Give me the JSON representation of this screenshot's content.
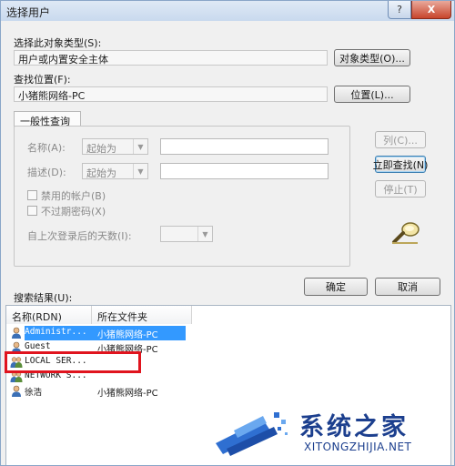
{
  "window": {
    "title": "选择用户",
    "help_label": "?",
    "close_label": "X"
  },
  "object_type": {
    "label": "选择此对象类型(S):",
    "value": "用户或内置安全主体",
    "button": "对象类型(O)..."
  },
  "location": {
    "label": "查找位置(F):",
    "value": "小猪熊网络-PC",
    "button": "位置(L)..."
  },
  "common_query": {
    "tab_label": "一般性查询",
    "name_label": "名称(A):",
    "name_mode": "起始为",
    "desc_label": "描述(D):",
    "desc_mode": "起始为",
    "disabled_accounts": "禁用的帐户(B)",
    "no_expire_password": "不过期密码(X)",
    "days_since_login": "自上次登录后的天数(I):"
  },
  "side_buttons": {
    "columns": "列(C)...",
    "find_now": "立即查找(N)",
    "stop": "停止(T)"
  },
  "actions": {
    "ok": "确定",
    "cancel": "取消"
  },
  "results": {
    "label": "搜索结果(U):",
    "columns": [
      "名称(RDN)",
      "所在文件夹"
    ],
    "rows": [
      {
        "name": "Administr...",
        "folder": "小猪熊网络-PC",
        "selected": true,
        "icon": "user-icon"
      },
      {
        "name": "Guest",
        "folder": "小猪熊网络-PC",
        "selected": false,
        "icon": "user-icon"
      },
      {
        "name": "LOCAL SER...",
        "folder": "",
        "selected": false,
        "icon": "group-icon"
      },
      {
        "name": "NETWORK S...",
        "folder": "",
        "selected": false,
        "icon": "group-icon"
      },
      {
        "name": "徐浩",
        "folder": "小猪熊网络-PC",
        "selected": false,
        "icon": "user-icon"
      }
    ]
  },
  "watermark": {
    "title": "系统之家",
    "url": "XITONGZHIJIA.NET"
  },
  "colors": {
    "selection": "#3399ff",
    "highlight_box": "#e0141e",
    "watermark": "#1c3f8e"
  }
}
